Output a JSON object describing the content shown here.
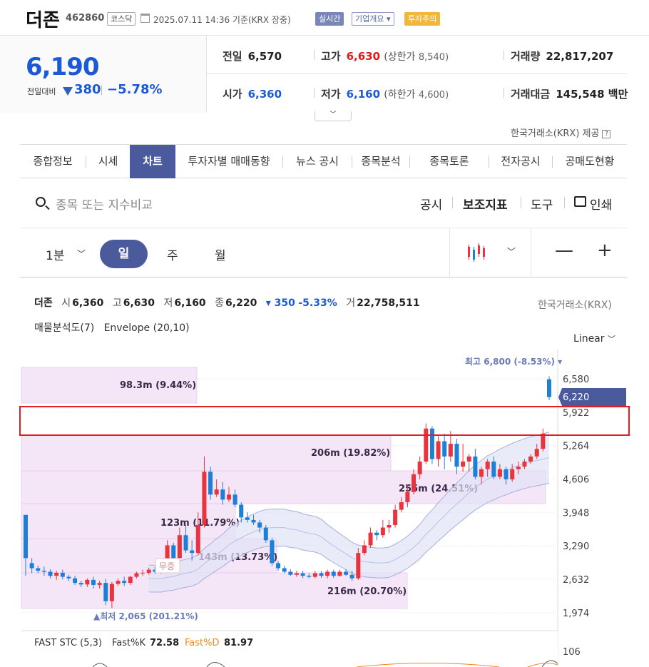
{
  "header": {
    "name": "더존",
    "code": "462860",
    "market": "코스닥",
    "datetime": "2025.07.11 14:36 기준(KRX 장중)",
    "badge_live": "실시간",
    "badge_info": "기업개요",
    "badge_warn": "투자주의"
  },
  "price": {
    "current": "6,190",
    "prev_label": "전일대비",
    "change": "380",
    "change_pct": "−5.78%"
  },
  "stats": {
    "prev_label": "전일",
    "prev": "6,570",
    "high_label": "고가",
    "high": "6,630",
    "upper_label": "(상한가",
    "upper": "8,540)",
    "volume_label": "거래량",
    "volume": "22,817,207",
    "open_label": "시가",
    "open": "6,360",
    "low_label": "저가",
    "low": "6,160",
    "lower_label": "(하한가",
    "lower": "4,600)",
    "amount_label": "거래대금",
    "amount": "145,548",
    "amount_unit": "백만"
  },
  "source": "한국거래소(KRX) 제공",
  "tabs": [
    "종합정보",
    "시세",
    "차트",
    "투자자별 매매동향",
    "뉴스 공시",
    "종목분석",
    "종목토론",
    "전자공시",
    "공매도현황"
  ],
  "search": {
    "placeholder": "종목 또는 지수비교"
  },
  "tools": {
    "notice": "공시",
    "indicator": "보조지표",
    "tool": "도구",
    "print": "인쇄"
  },
  "periods": {
    "minute": "1분",
    "day": "일",
    "week": "주",
    "month": "월"
  },
  "chart_info": {
    "name": "더존",
    "open_k": "시",
    "open": "6,360",
    "high_k": "고",
    "high": "6,630",
    "low_k": "저",
    "low": "6,160",
    "close_k": "종",
    "close": "6,220",
    "change": "▾ 350",
    "change_pct": "-5.33%",
    "vol_k": "거",
    "volume": "22,758,511",
    "exchange": "한국거래소(KRX)",
    "indicators": "매물분석도(7)   Envelope (20,10)",
    "scale": "Linear"
  },
  "chart_data": {
    "type": "candlestick",
    "y_ticks": [
      "6,580",
      "5,922",
      "5,264",
      "4,606",
      "3,948",
      "3,290",
      "2,632",
      "1,974"
    ],
    "current_label": "6,220",
    "max_label": "최고 6,800 (-8.53%) ▾",
    "min_label": "▲최저 2,065 (201.21%)",
    "event_label": "무증",
    "volume_profile": [
      {
        "label": "98.3m (9.44%)"
      },
      {
        "label": "206m (19.82%)"
      },
      {
        "label": "255m (24.51%)"
      },
      {
        "label": "123m (11.79%)"
      },
      {
        "label": "143m (13.73%)"
      },
      {
        "label": "216m (20.70%)"
      }
    ],
    "candles": [
      [
        3900,
        3050,
        3150,
        2700
      ],
      [
        2950,
        2850,
        3050,
        2750
      ],
      [
        2850,
        2800,
        2900,
        2750
      ],
      [
        2800,
        2780,
        2880,
        2700
      ],
      [
        2780,
        2700,
        2830,
        2650
      ],
      [
        2700,
        2760,
        2800,
        2620
      ],
      [
        2760,
        2680,
        2820,
        2630
      ],
      [
        2680,
        2650,
        2720,
        2600
      ],
      [
        2650,
        2560,
        2700,
        2520
      ],
      [
        2560,
        2530,
        2600,
        2480
      ],
      [
        2530,
        2620,
        2650,
        2480
      ],
      [
        2620,
        2520,
        2680,
        2450
      ],
      [
        2520,
        2560,
        2600,
        2450
      ],
      [
        2560,
        2200,
        2640,
        2120
      ],
      [
        2200,
        2540,
        2580,
        2065
      ],
      [
        2540,
        2600,
        2650,
        2500
      ],
      [
        2600,
        2560,
        2680,
        2500
      ],
      [
        2560,
        2680,
        2700,
        2520
      ],
      [
        2680,
        2750,
        2780,
        2650
      ],
      [
        2750,
        2760,
        2820,
        2700
      ],
      [
        2760,
        2820,
        2860,
        2720
      ],
      [
        2820,
        2780,
        2880,
        2740
      ],
      [
        2780,
        2810,
        2850,
        2740
      ],
      [
        2810,
        3300,
        3400,
        2800
      ],
      [
        3300,
        3050,
        3350,
        2950
      ],
      [
        3050,
        3500,
        3650,
        3000
      ],
      [
        3500,
        3200,
        3700,
        3150
      ],
      [
        3200,
        3150,
        3400,
        3000
      ],
      [
        3150,
        3700,
        3950,
        3100
      ],
      [
        3700,
        4750,
        5050,
        3650
      ],
      [
        4750,
        4300,
        4850,
        4200
      ],
      [
        4300,
        4400,
        4600,
        4250
      ],
      [
        4400,
        4200,
        4550,
        4100
      ],
      [
        4200,
        4300,
        4450,
        4150
      ],
      [
        4300,
        4100,
        4400,
        4050
      ],
      [
        4100,
        3850,
        4150,
        3750
      ],
      [
        3850,
        3800,
        3950,
        3750
      ],
      [
        3800,
        3750,
        3900,
        3700
      ],
      [
        3750,
        3650,
        3800,
        3550
      ],
      [
        3650,
        3400,
        3700,
        3350
      ],
      [
        3400,
        2950,
        3450,
        2900
      ],
      [
        2950,
        2850,
        3000,
        2800
      ],
      [
        2850,
        2780,
        2900,
        2750
      ],
      [
        2780,
        2720,
        2830,
        2700
      ],
      [
        2720,
        2750,
        2800,
        2680
      ],
      [
        2750,
        2700,
        2800,
        2650
      ],
      [
        2700,
        2680,
        2750,
        2650
      ],
      [
        2680,
        2750,
        2800,
        2650
      ],
      [
        2750,
        2700,
        2790,
        2660
      ],
      [
        2700,
        2780,
        2820,
        2650
      ],
      [
        2780,
        2700,
        2820,
        2660
      ],
      [
        2700,
        2780,
        2820,
        2680
      ],
      [
        2780,
        2720,
        2830,
        2700
      ],
      [
        2720,
        2650,
        2800,
        2600
      ],
      [
        2650,
        3150,
        3250,
        2620
      ],
      [
        3150,
        3300,
        3400,
        3100
      ],
      [
        3300,
        3550,
        3650,
        3250
      ],
      [
        3550,
        3500,
        3600,
        3400
      ],
      [
        3500,
        3650,
        3800,
        3450
      ],
      [
        3650,
        3700,
        3800,
        3550
      ],
      [
        3700,
        4000,
        4100,
        3650
      ],
      [
        4000,
        4150,
        4250,
        3950
      ],
      [
        4150,
        4350,
        4500,
        4050
      ],
      [
        4350,
        4700,
        4800,
        4300
      ],
      [
        4700,
        4950,
        5050,
        4600
      ],
      [
        4950,
        5600,
        5700,
        4900
      ],
      [
        5600,
        5000,
        5650,
        4900
      ],
      [
        5000,
        5350,
        5450,
        4850
      ],
      [
        5350,
        5050,
        5500,
        4800
      ],
      [
        5050,
        5300,
        5550,
        4950
      ],
      [
        5300,
        4850,
        5400,
        4700
      ],
      [
        4850,
        4950,
        5300,
        4750
      ],
      [
        4950,
        5050,
        5100,
        4750
      ],
      [
        5050,
        4650,
        5200,
        4600
      ],
      [
        4650,
        4800,
        4850,
        4500
      ],
      [
        4800,
        4950,
        5000,
        4650
      ],
      [
        4950,
        4650,
        5050,
        4600
      ],
      [
        4650,
        4800,
        4900,
        4600
      ],
      [
        4800,
        4600,
        4850,
        4500
      ],
      [
        4600,
        4800,
        4900,
        4550
      ],
      [
        4800,
        4850,
        4950,
        4700
      ],
      [
        4850,
        4950,
        5000,
        4800
      ],
      [
        4950,
        5050,
        5100,
        4900
      ],
      [
        5050,
        5200,
        5300,
        5000
      ],
      [
        5200,
        5500,
        5600,
        5150
      ],
      [
        6570,
        6220,
        6630,
        6160
      ]
    ]
  },
  "oscillator": {
    "name": "FAST STC (5,3)",
    "k_label": "Fast%K",
    "k_val": "72.58",
    "d_label": "Fast%D",
    "d_val": "81.97",
    "tick": "106"
  },
  "colors": {
    "up": "#e8343e",
    "down": "#1e7fd6",
    "accent": "#4a5a9c",
    "highlight": "#e02020"
  }
}
